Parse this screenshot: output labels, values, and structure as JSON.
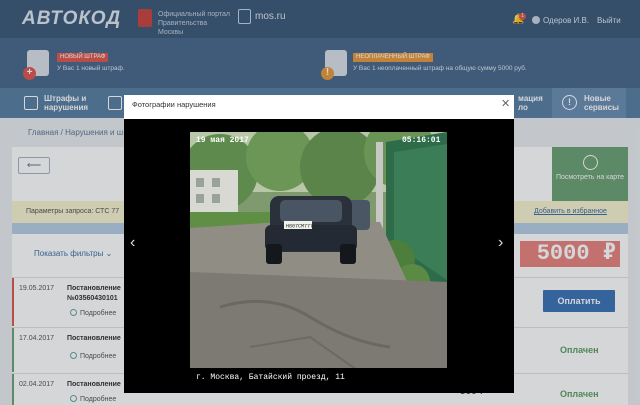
{
  "header": {
    "logo": "АВТОКОД",
    "portal": "Официальный портал Правительства Москвы",
    "mos": "mos.ru",
    "bell_count": "1",
    "user": "Одеров И.В.",
    "logout": "Выйти"
  },
  "notifications": [
    {
      "tag": "НОВЫЙ ШТРАФ",
      "text": "У Вас 1 новый штраф.",
      "tag_color": "#e0584f",
      "badge": "+",
      "badge_color": "#e0584f"
    },
    {
      "tag": "НЕОПЛАЧЕННЫЙ ШТРАФ",
      "text": "У Вас 1 неоплаченный штраф на общую сумму 5000 руб.",
      "tag_color": "#e89a3c",
      "badge": "!",
      "badge_color": "#e89a3c"
    }
  ],
  "nav": {
    "fines": "Штрафы и нарушения",
    "right_partial": "мация ло",
    "new_services": "Новые сервисы"
  },
  "breadcrumb": "Главная  /  Нарушения и ш",
  "map_button": "Посмотреть на карте",
  "params": {
    "label": "Параметры запроса:  СТС 77",
    "favorite": "Добавить в избранное"
  },
  "filters": "Показать фильтры",
  "amount": "5000 ₽",
  "rows": [
    {
      "date": "19.05.2017",
      "title": "Постановление",
      "number": "№03560430101",
      "more": "Подробнее",
      "status": "Оплатить"
    },
    {
      "date": "17.04.2017",
      "title": "Постановление",
      "more": "Подробнее",
      "status": "Оплачен"
    },
    {
      "date": "02.04.2017",
      "title": "Постановление",
      "more": "Подробнее",
      "status": "Оплачен",
      "sum": "500 ₽"
    }
  ],
  "modal": {
    "title": "Фотографии нарушения",
    "photo_date": "19 мая 2017",
    "photo_time": "05:16:01",
    "plate": "Н807СМ777",
    "photo_caption": "г. Москва, Батайский проезд, 11"
  }
}
